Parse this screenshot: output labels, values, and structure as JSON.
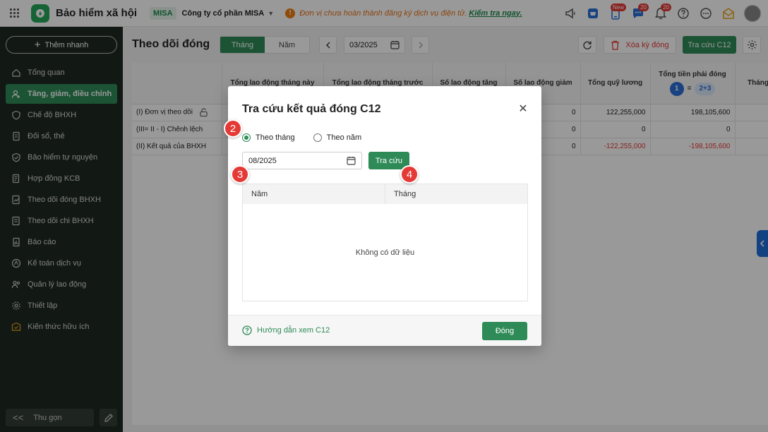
{
  "topbar": {
    "app_title": "Bảo hiểm xã hội",
    "brand_tag": "MISA",
    "company": "Công ty cổ phần MISA",
    "warning_text": "Đơn vị chưa hoàn thành đăng ký dịch vụ điện tử.",
    "warning_link": "Kiểm tra ngay.",
    "new_badge": "New",
    "chat_count": "20",
    "notif_count": "20"
  },
  "sidebar": {
    "quick_add": "Thêm nhanh",
    "items": [
      {
        "label": "Tổng quan",
        "icon": "home-icon"
      },
      {
        "label": "Tăng, giảm, điều chỉnh",
        "icon": "user-adjust-icon"
      },
      {
        "label": "Chế độ BHXH",
        "icon": "shield-heart-icon"
      },
      {
        "label": "Đối sổ, thẻ",
        "icon": "card-icon"
      },
      {
        "label": "Bảo hiểm tự nguyện",
        "icon": "shield-icon"
      },
      {
        "label": "Hợp đồng KCB",
        "icon": "contract-icon"
      },
      {
        "label": "Theo dõi đóng BHXH",
        "icon": "tracking-icon"
      },
      {
        "label": "Theo dõi chi BHXH",
        "icon": "payout-icon"
      },
      {
        "label": "Báo cáo",
        "icon": "report-icon"
      },
      {
        "label": "Kế toán dịch vụ",
        "icon": "accounting-icon"
      },
      {
        "label": "Quản lý lao động",
        "icon": "people-icon"
      },
      {
        "label": "Thiết lập",
        "icon": "settings-icon"
      },
      {
        "label": "Kiến thức hữu ích",
        "icon": "knowledge-icon"
      }
    ],
    "active_index": 1,
    "collapse": "Thu gọn"
  },
  "toolbar": {
    "page_title": "Theo dõi đóng",
    "seg_month": "Tháng",
    "seg_year": "Năm",
    "period": "03/2025",
    "delete": "Xóa kỳ đóng",
    "lookup": "Tra cứu C12"
  },
  "table": {
    "headers": [
      "",
      "Tổng lao động tháng này",
      "Tổng lao động tháng trước",
      "Số lao động tăng",
      "Số lao động giảm",
      "Tổng quỹ lương",
      "Tổng tiền phải đóng",
      "Tháng"
    ],
    "formula": {
      "a": "1",
      "eq": "=",
      "b": "2+3"
    },
    "rows": [
      {
        "label": "(I) Đơn vị theo dõi",
        "cols": [
          "",
          "",
          "",
          "0",
          "122,255,000",
          "198,105,600"
        ]
      },
      {
        "label": "(III= II - I) Chênh lệch",
        "cols": [
          "",
          "",
          "",
          "0",
          "0",
          "0"
        ]
      },
      {
        "label": "(II) Kết quả của BHXH",
        "cols": [
          "",
          "",
          "",
          "0",
          "-122,255,000",
          "-198,105,600"
        ]
      }
    ]
  },
  "modal": {
    "title": "Tra cứu kết quả đóng C12",
    "radio_month": "Theo tháng",
    "radio_year": "Theo năm",
    "selected": "month",
    "date_value": "08/2025",
    "search": "Tra cứu",
    "col_year": "Năm",
    "col_month": "Tháng",
    "empty": "Không có dữ liệu",
    "help": "Hướng dẫn xem C12",
    "close": "Đóng"
  },
  "steps": [
    "2",
    "3",
    "4"
  ],
  "colors": {
    "primary": "#2e8b57",
    "sidebar": "#1f2a24",
    "danger": "#e53935",
    "warning": "#f07d12",
    "info": "#2b6fd6"
  }
}
